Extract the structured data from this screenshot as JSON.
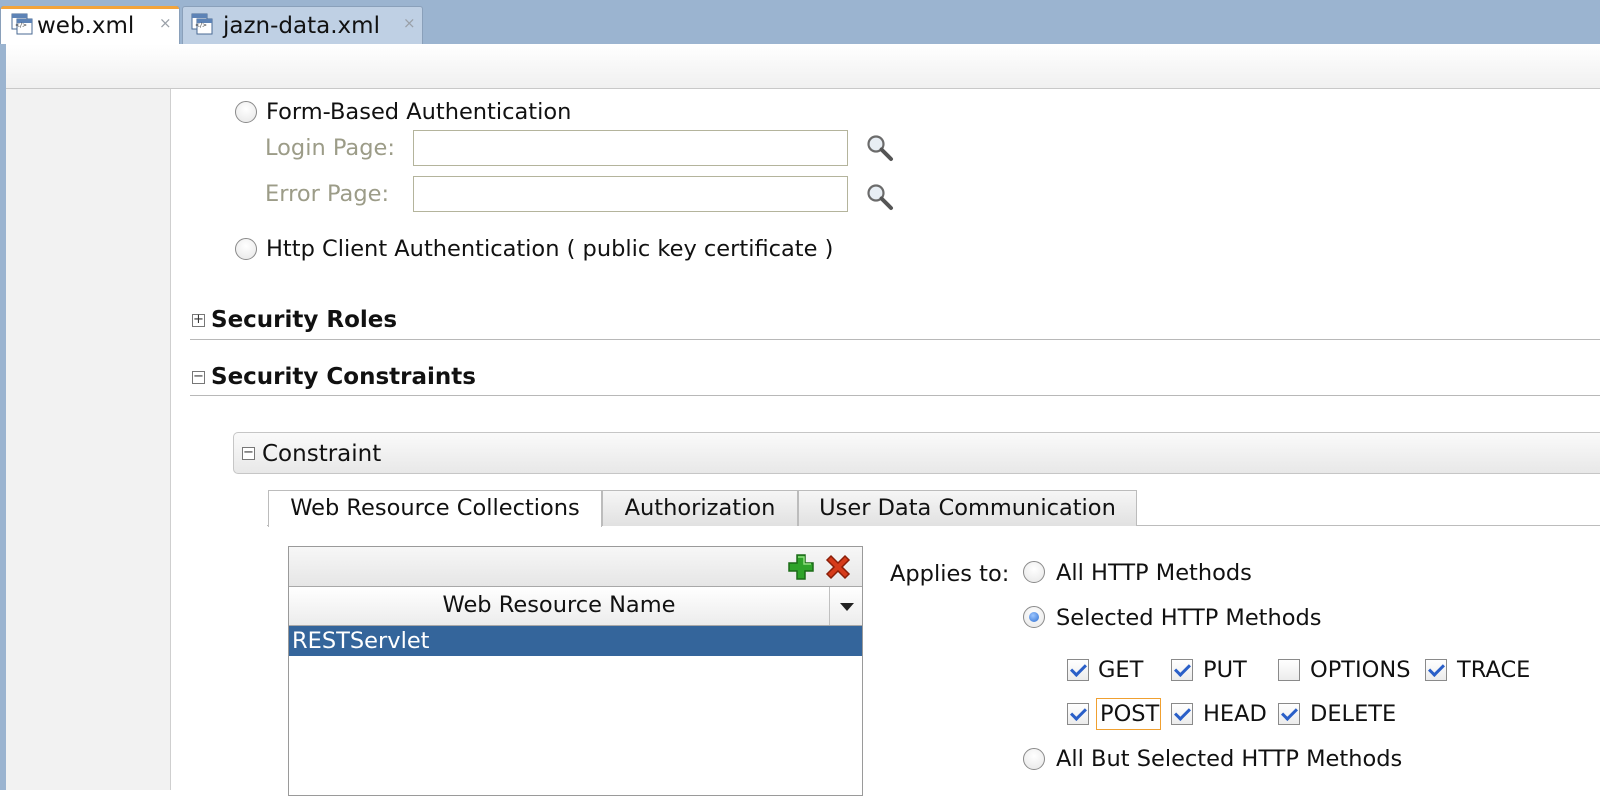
{
  "editor_tabs": [
    {
      "label": "web.xml",
      "icon": "xml-file-icon",
      "active": true
    },
    {
      "label": "jazn-data.xml",
      "icon": "xml-file-icon",
      "active": false
    }
  ],
  "close_glyph": "×",
  "auth": {
    "form_based_label": "Form-Based Authentication",
    "login_page_label": "Login Page:",
    "login_page_value": "",
    "error_page_label": "Error Page:",
    "error_page_value": "",
    "client_cert_label": "Http Client Authentication ( public key certificate )"
  },
  "sections": {
    "security_roles": "Security Roles",
    "security_constraints": "Security Constraints",
    "constraint": "Constraint"
  },
  "expand_glyph": "+",
  "collapse_glyph": "−",
  "constraint_tabs": [
    "Web Resource Collections",
    "Authorization",
    "User Data Communication"
  ],
  "resource_table": {
    "column_header": "Web Resource Name",
    "rows": [
      "RESTServlet"
    ],
    "add_icon": "add-icon",
    "delete_icon": "delete-icon"
  },
  "http_methods": {
    "applies_to_label": "Applies to:",
    "all_label": "All HTTP Methods",
    "selected_label": "Selected HTTP Methods",
    "all_but_label": "All But Selected HTTP Methods",
    "selected_option": "selected",
    "methods": [
      {
        "name": "GET",
        "checked": true
      },
      {
        "name": "PUT",
        "checked": true
      },
      {
        "name": "OPTIONS",
        "checked": false
      },
      {
        "name": "TRACE",
        "checked": true
      },
      {
        "name": "POST",
        "checked": true
      },
      {
        "name": "HEAD",
        "checked": true
      },
      {
        "name": "DELETE",
        "checked": true
      }
    ]
  },
  "colors": {
    "tabstrip": "#9bb4d0",
    "selection": "#34659b",
    "add_green": "#2fa32a",
    "delete_red": "#d63b1a",
    "focus_orange": "#f0a030"
  }
}
